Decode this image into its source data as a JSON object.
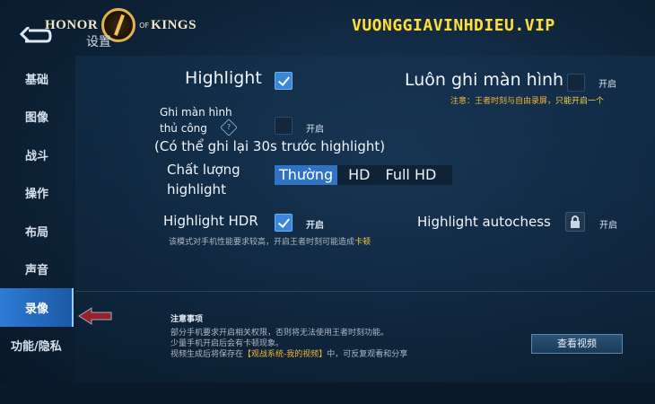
{
  "header": {
    "logo_left": "HONOR",
    "logo_of": "OF",
    "logo_right": "KINGS",
    "title": "设置",
    "watermark": "VUONGGIAVINHDIEU.VIP"
  },
  "sidebar": {
    "items": [
      {
        "label": "基础"
      },
      {
        "label": "图像"
      },
      {
        "label": "战斗"
      },
      {
        "label": "操作"
      },
      {
        "label": "布局"
      },
      {
        "label": "声音"
      },
      {
        "label": "录像",
        "active": true
      },
      {
        "label": "功能/隐私"
      }
    ]
  },
  "settings": {
    "highlight": {
      "label": "Highlight",
      "checked": true
    },
    "always_record": {
      "label": "Luôn ghi màn hình",
      "checked": false,
      "on_label": "开启",
      "note_prefix": "注意：王者时刻与自由录屏，",
      "note_highlight": "只能开启一个"
    },
    "manual_record": {
      "label_line1": "Ghi màn hình",
      "label_line2": "thủ công",
      "checked": false,
      "on_label": "开启",
      "desc": "(Có thể ghi lại 30s trước highlight)"
    },
    "quality": {
      "label_line1": "Chất lượng",
      "label_line2": "highlight",
      "options": [
        "Thường",
        "HD",
        "Full HD"
      ],
      "selected": "Thường"
    },
    "highlight_hdr": {
      "label": "Highlight HDR",
      "checked": true,
      "on_label": "开启",
      "note_prefix": "该模式对手机性能要求较高，开启王者时刻可能造成",
      "note_highlight": "卡顿"
    },
    "highlight_autochess": {
      "label": "Highlight autochess",
      "locked": true,
      "on_label": "开启"
    }
  },
  "notice": {
    "title": "注意事项",
    "line1": "部分手机要求开启相关权限，否则将无法使用王者时刻功能。",
    "line2": "少量手机开启后会有卡顿现象。",
    "line3_prefix": "视频生成后将保存在",
    "line3_highlight": "【观战系统-我的视频】",
    "line3_suffix": "中，可反复观看和分享",
    "view_button": "查看视频"
  },
  "colors": {
    "accent": "#2f73c2",
    "warning": "#f2b63a",
    "watermark": "#f5e14a"
  }
}
